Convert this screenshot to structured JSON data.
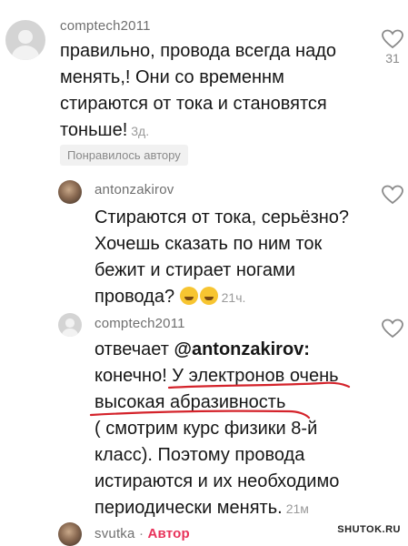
{
  "comments": [
    {
      "username": "comptech2011",
      "lines": [
        "правильно, провода всегда надо",
        "менять,! Они со временнм",
        "стираются от тока и становятся",
        "тоньше!"
      ],
      "time": "3д.",
      "likes": "31",
      "badge": "Понравилось автору",
      "icon": "heart-outline"
    },
    {
      "username": "antonzakirov",
      "lines": [
        "Стираются от тока, серьёзно?",
        "Хочешь сказать по ним ток",
        "бежит и стирает ногами",
        "провода?"
      ],
      "emoji": "😂😁",
      "time": "21ч.",
      "icon": "heart-outline"
    },
    {
      "username": "comptech2011",
      "line1_prefix": "отвечает",
      "mention": "@antonzakirov:",
      "lines": [
        "конечно! У электронов очень",
        "высокая абразивность",
        "( смотрим курс физики 8-й",
        "класс). Поэтому провода",
        "истираются и их необходимо",
        "периодически менять."
      ],
      "time": "21м",
      "icon": "heart-outline"
    },
    {
      "username": "svutka",
      "separator": "·",
      "author_label": "Автор"
    }
  ],
  "watermark": "SHUTOK.RU",
  "colors": {
    "author_accent": "#e8325a",
    "underline": "#d4232b"
  }
}
